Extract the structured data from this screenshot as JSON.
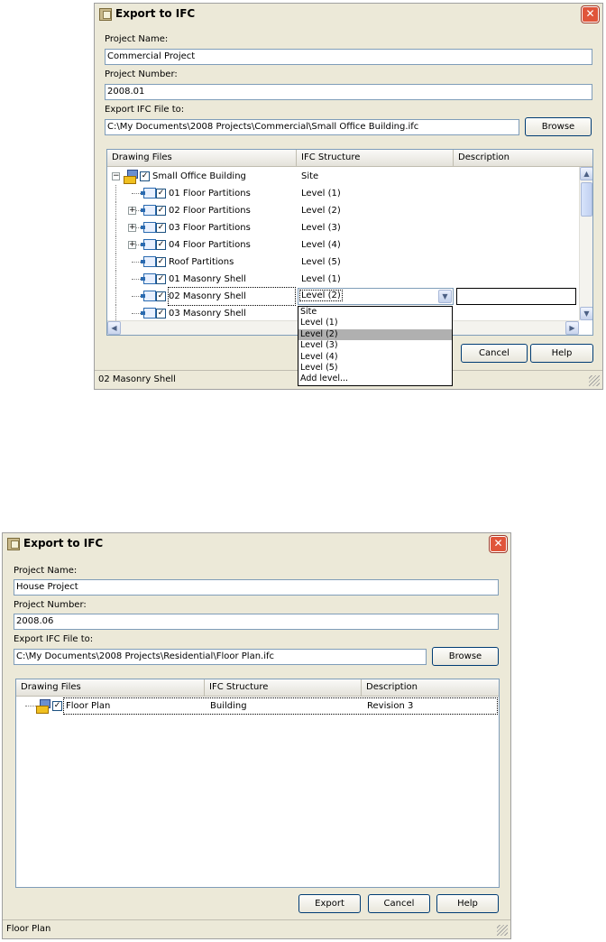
{
  "dialog1": {
    "title": "Export to IFC",
    "project_name_label": "Project Name:",
    "project_name_value": "Commercial Project",
    "project_number_label": "Project Number:",
    "project_number_value": "2008.01",
    "export_file_label": "Export IFC File to:",
    "export_file_value": "C:\\My Documents\\2008 Projects\\Commercial\\Small Office Building.ifc",
    "browse_label": "Browse",
    "columns": [
      "Drawing Files",
      "IFC Structure",
      "Description"
    ],
    "rows": [
      {
        "name": "Small Office Building",
        "ifc": "Site",
        "checked": true,
        "expander": "−",
        "icon": "dwg-file-icon"
      },
      {
        "name": "01 Floor Partitions",
        "ifc": "Level (1)",
        "checked": true,
        "expander": "",
        "icon": "xref-icon"
      },
      {
        "name": "02 Floor Partitions",
        "ifc": "Level (2)",
        "checked": true,
        "expander": "+",
        "icon": "xref-icon"
      },
      {
        "name": "03 Floor Partitions",
        "ifc": "Level (3)",
        "checked": true,
        "expander": "+",
        "icon": "xref-icon"
      },
      {
        "name": "04 Floor Partitions",
        "ifc": "Level (4)",
        "checked": true,
        "expander": "+",
        "icon": "xref-icon"
      },
      {
        "name": "Roof Partitions",
        "ifc": "Level (5)",
        "checked": true,
        "expander": "",
        "icon": "xref-icon"
      },
      {
        "name": "01 Masonry Shell",
        "ifc": "Level (1)",
        "checked": true,
        "expander": "",
        "icon": "xref-icon"
      },
      {
        "name": "02 Masonry Shell",
        "ifc": "Level (2)",
        "checked": true,
        "expander": "",
        "icon": "xref-icon"
      },
      {
        "name": "03 Masonry Shell",
        "ifc": "",
        "checked": true,
        "expander": "",
        "icon": "xref-icon"
      }
    ],
    "combo_value": "Level (2)",
    "dropdown_options": [
      "Site",
      "Level (1)",
      "Level (2)",
      "Level (3)",
      "Level (4)",
      "Level (5)",
      "Add level..."
    ],
    "dropdown_highlighted": "Level (2)",
    "ok_label": "",
    "cancel_label": "Cancel",
    "help_label": "Help",
    "status": "02 Masonry Shell"
  },
  "dialog2": {
    "title": "Export to IFC",
    "project_name_label": "Project Name:",
    "project_name_value": "House Project",
    "project_number_label": "Project Number:",
    "project_number_value": "2008.06",
    "export_file_label": "Export IFC File to:",
    "export_file_value": "C:\\My Documents\\2008 Projects\\Residential\\Floor Plan.ifc",
    "browse_label": "Browse",
    "columns": [
      "Drawing Files",
      "IFC Structure",
      "Description"
    ],
    "rows": [
      {
        "name": "Floor Plan",
        "ifc": "Building",
        "description": "Revision 3",
        "checked": true,
        "icon": "dwg-file-icon"
      }
    ],
    "export_label": "Export",
    "cancel_label": "Cancel",
    "help_label": "Help",
    "status": "Floor Plan"
  },
  "colors": {
    "dialog_bg": "#ece9d8",
    "field_border": "#7f9db9",
    "close_red": "#e0553a",
    "button_border": "#003c74",
    "highlight": "#b0b0b0"
  }
}
